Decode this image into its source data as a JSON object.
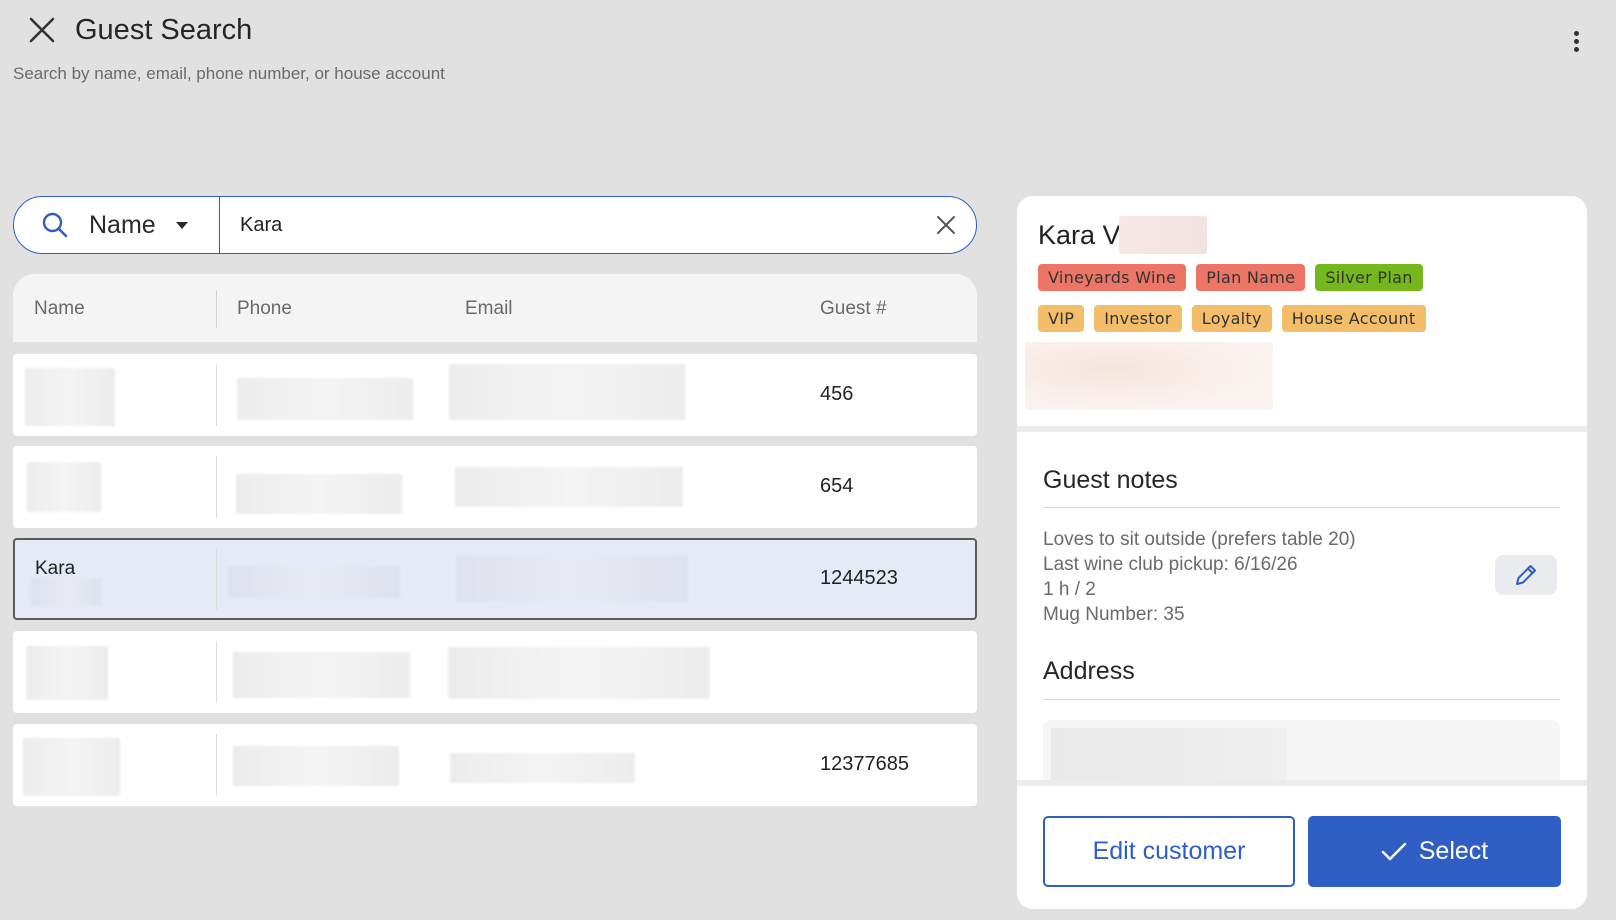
{
  "header": {
    "title": "Guest Search",
    "subtitle": "Search by name, email, phone number, or house account"
  },
  "search": {
    "type_label": "Name",
    "query": "Kara"
  },
  "table": {
    "columns": [
      "Name",
      "Phone",
      "Email",
      "Guest #"
    ],
    "rows": [
      {
        "name": "",
        "guest_number": "456"
      },
      {
        "name": "",
        "guest_number": "654"
      },
      {
        "name": "Kara",
        "guest_number": "1244523",
        "selected": true
      },
      {
        "name": "",
        "guest_number": ""
      },
      {
        "name": "",
        "guest_number": "12377685"
      }
    ]
  },
  "detail": {
    "name": "Kara V",
    "tags_row1": [
      {
        "label": "Vineyards Wine",
        "color": "#ec7565"
      },
      {
        "label": "Plan Name",
        "color": "#ec7565"
      },
      {
        "label": "Silver Plan",
        "color": "#74b81d"
      }
    ],
    "tags_row2": [
      {
        "label": "VIP",
        "color": "#f3bd6a"
      },
      {
        "label": "Investor",
        "color": "#f3bd6a"
      },
      {
        "label": "Loyalty",
        "color": "#f3bd6a"
      },
      {
        "label": "House Account",
        "color": "#f3bd6a"
      }
    ],
    "notes_title": "Guest notes",
    "notes": [
      "Loves to sit outside (prefers table 20)",
      "Last wine club pickup: 6/16/26",
      "1 h / 2",
      "Mug Number: 35"
    ],
    "address_title": "Address",
    "edit_button": "Edit customer",
    "select_button": "Select"
  },
  "colors": {
    "accent": "#2f5fc4",
    "selected_row": "#e6e9f6",
    "background": "#e1e1e1"
  },
  "icons": [
    "close-icon",
    "more-vert-icon",
    "search-icon",
    "dropdown-caret-icon",
    "clear-icon",
    "pencil-icon",
    "check-icon"
  ]
}
